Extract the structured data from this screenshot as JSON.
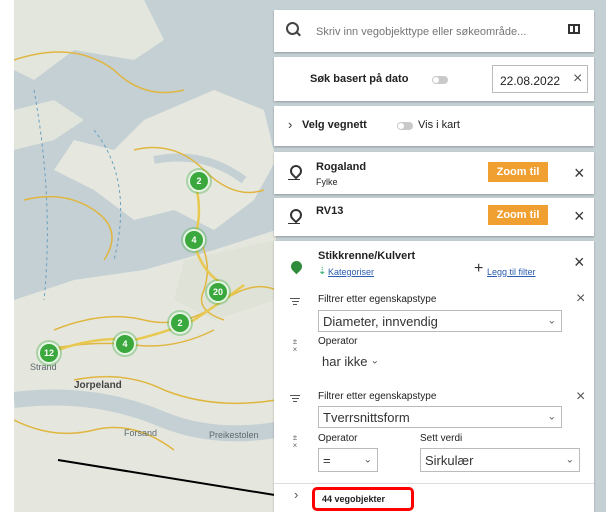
{
  "map": {
    "places": [
      "Strand",
      "Jorpeland",
      "Forsand",
      "Preikestolen"
    ],
    "clusters": [
      "2",
      "4",
      "20",
      "2",
      "4",
      "12"
    ]
  },
  "search": {
    "placeholder": "Skriv inn vegobjekttype eller søkeområde..."
  },
  "date_search": {
    "label": "Søk basert på dato",
    "value": "22.08.2022"
  },
  "road_network": {
    "label": "Velg vegnett",
    "show_label": "Vis i kart"
  },
  "locations": [
    {
      "name": "Rogaland",
      "type": "Fylke",
      "zoom_label": "Zoom til"
    },
    {
      "name": "RV13",
      "zoom_label": "Zoom til"
    }
  ],
  "object_type": {
    "name": "Stikkrenne/Kulvert",
    "categorize_label": "Kategoriser",
    "add_filter_label": "Legg til filter",
    "filters": [
      {
        "title": "Filtrer etter egenskapstype",
        "property": "Diameter, innvendig",
        "operator_label": "Operator",
        "operator": "har ikke"
      },
      {
        "title": "Filtrer etter egenskapstype",
        "property": "Tverrsnittsform",
        "operator_label": "Operator",
        "operator": "=",
        "value_label": "Sett verdi",
        "value": "Sirkulær"
      }
    ]
  },
  "result": {
    "count_label": "44 vegobjekter"
  },
  "colors": {
    "accent": "#f0a030",
    "cluster": "#3aa83c",
    "highlight": "#ff0000",
    "location_pin": "#2e8b3a"
  }
}
